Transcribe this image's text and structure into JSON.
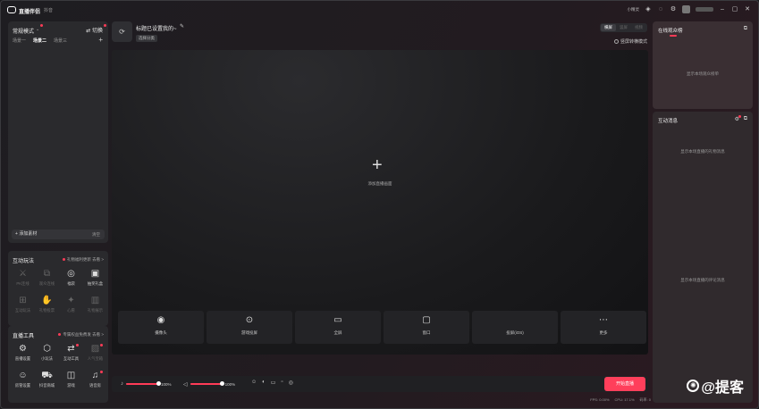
{
  "app": {
    "name": "直播伴侣",
    "sub": "抖音",
    "status_text": "小精灵"
  },
  "left": {
    "mode": "常规模式",
    "switch": "切换",
    "scenes": [
      "场景一",
      "场景二",
      "场景三"
    ],
    "add_material": "添加素材",
    "clear": "清空"
  },
  "interactive": {
    "title": "互动玩法",
    "hint": "礼物福利更新 去看 >",
    "tools": [
      {
        "icon": "pk-icon",
        "glyph": "⚔",
        "label": "PK连线",
        "dim": true
      },
      {
        "icon": "link-icon",
        "glyph": "⧉",
        "label": "观众连线",
        "dim": true
      },
      {
        "icon": "gift-icon",
        "glyph": "◎",
        "label": "福袋",
        "dim": false
      },
      {
        "icon": "cup-icon",
        "glyph": "▣",
        "label": "抽奖礼盒",
        "dim": false
      },
      {
        "icon": "game-icon",
        "glyph": "⊞",
        "label": "互动玩法",
        "dim": true
      },
      {
        "icon": "hand-icon",
        "glyph": "✋",
        "label": "礼物投票",
        "dim": true
      },
      {
        "icon": "star-icon",
        "glyph": "✦",
        "label": "心愿",
        "dim": true
      },
      {
        "icon": "chart-icon",
        "glyph": "▥",
        "label": "礼物展示",
        "dim": true
      }
    ]
  },
  "live_tools": {
    "title": "直播工具",
    "hint": "专属权益免费发 去看 >",
    "tools": [
      {
        "icon": "settings-icon",
        "glyph": "⚙",
        "label": "直播设置",
        "dim": false,
        "badge": false
      },
      {
        "icon": "program-icon",
        "glyph": "⬡",
        "label": "小玩法",
        "dim": false,
        "badge": false
      },
      {
        "icon": "flow-icon",
        "glyph": "⇄",
        "label": "互动工具",
        "dim": false,
        "badge": true
      },
      {
        "icon": "image-icon",
        "glyph": "▨",
        "label": "人气宝箱",
        "dim": true,
        "badge": true
      },
      {
        "icon": "user-icon",
        "glyph": "☺",
        "label": "房管设置",
        "dim": false,
        "badge": false
      },
      {
        "icon": "cart-icon",
        "glyph": "⛟",
        "label": "抖音商城",
        "dim": false,
        "badge": false
      },
      {
        "icon": "gamepad-icon",
        "glyph": "◫",
        "label": "游戏",
        "dim": false,
        "badge": false
      },
      {
        "icon": "headset-icon",
        "glyph": "♫",
        "label": "语音房",
        "dim": false,
        "badge": true
      }
    ]
  },
  "header": {
    "live_title": "标题已设置我的~",
    "category": "选择分类",
    "orientations": [
      "横屏",
      "竖屏",
      "视频"
    ],
    "landscape_mode": "竖屏转横模式"
  },
  "preview": {
    "add_source": "添加直播画面",
    "sources": [
      {
        "icon": "camera-icon",
        "glyph": "◉",
        "label": "摄像头"
      },
      {
        "icon": "gamepad-icon",
        "glyph": "⊙",
        "label": "游戏投屏"
      },
      {
        "icon": "monitor-icon",
        "glyph": "▭",
        "label": "全屏"
      },
      {
        "icon": "window-icon",
        "glyph": "▢",
        "label": "窗口"
      },
      {
        "icon": "apple-icon",
        "glyph": "",
        "label": "投屏(iOS)"
      },
      {
        "icon": "more-icon",
        "glyph": "⋯",
        "label": "更多"
      }
    ]
  },
  "controls": {
    "mic_volume": "100%",
    "speaker_volume": "100%",
    "mic_level": 1.0,
    "speaker_level": 1.0,
    "go_live": "开始直播"
  },
  "right": {
    "online_title": "在线观众榜",
    "online_empty": "显示本场观众榜单",
    "chat_title": "互动消息",
    "chat_empty_top": "显示本场直播的礼物消息",
    "chat_empty_bottom": "显示本场直播的评论消息"
  },
  "status": {
    "fps": "FPS: 0.00%",
    "cpu": "CPU: 17.1%",
    "bitrate": "码率: 0"
  },
  "watermark": "@提客"
}
